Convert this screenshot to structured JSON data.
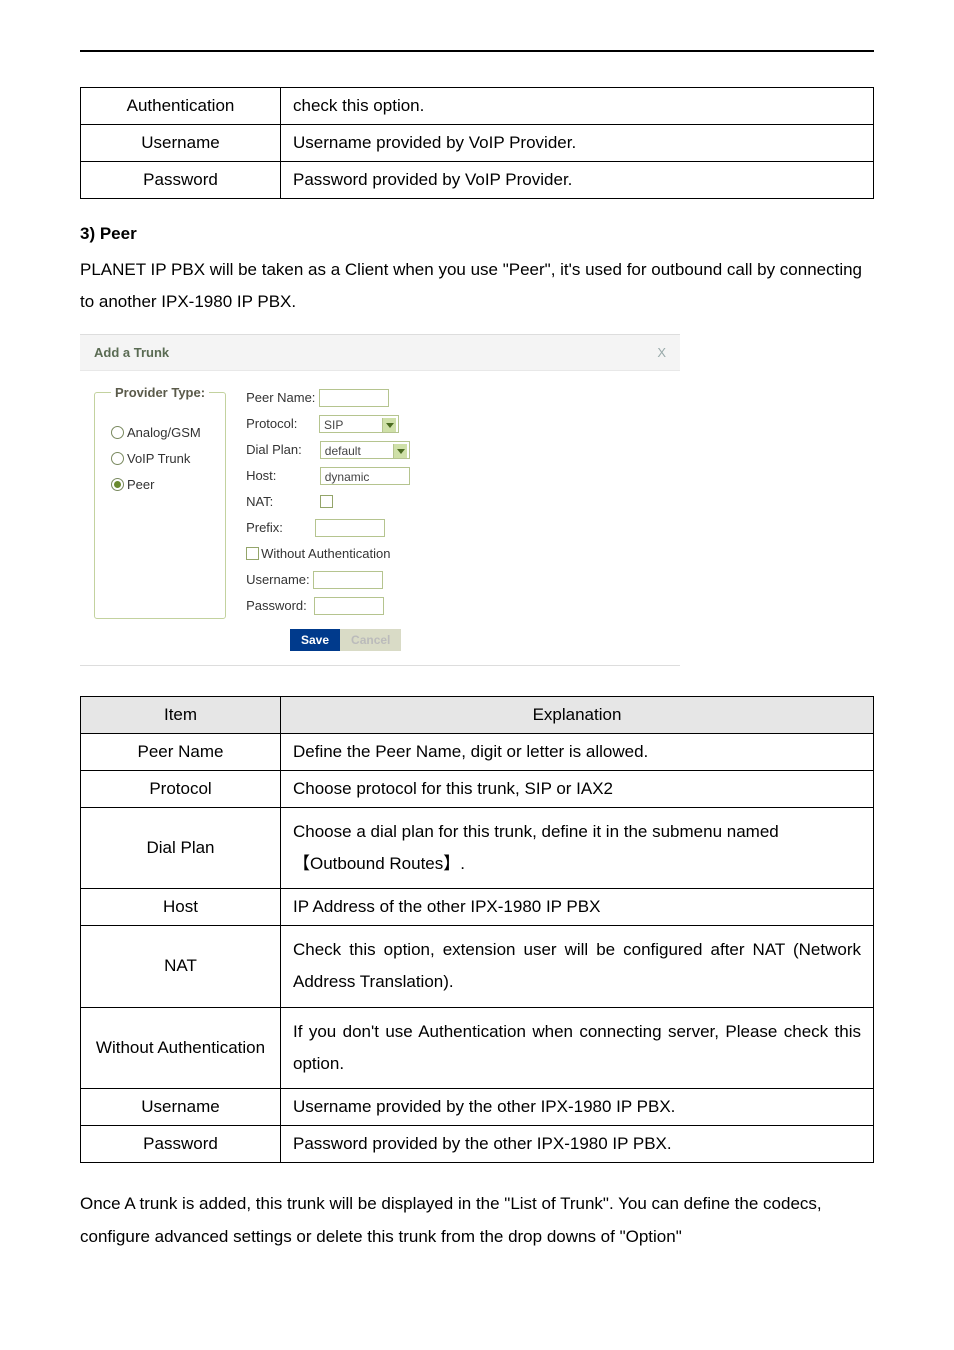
{
  "top_table": {
    "rows": [
      {
        "label": "Authentication",
        "desc": "check this option."
      },
      {
        "label": "Username",
        "desc": "Username provided by VoIP Provider."
      },
      {
        "label": "Password",
        "desc": "Password provided by VoIP Provider."
      }
    ]
  },
  "section": {
    "heading": "3) Peer",
    "para": "PLANET IP PBX will be taken as a Client when you use \"Peer\", it's used for outbound call by connecting to another IPX-1980 IP PBX."
  },
  "dialog": {
    "title": "Add a Trunk",
    "close": "X",
    "legend": "Provider Type:",
    "radios": [
      {
        "label": "Analog/GSM",
        "selected": false
      },
      {
        "label": "VoIP Trunk",
        "selected": false
      },
      {
        "label": "Peer",
        "selected": true
      }
    ],
    "fields": {
      "peer_name_label": "Peer Name:",
      "protocol_label": "Protocol:",
      "protocol_value": "SIP",
      "dial_plan_label": "Dial Plan:",
      "dial_plan_value": "default",
      "host_label": "Host:",
      "host_value": "dynamic",
      "nat_label": "NAT:",
      "prefix_label": "Prefix:",
      "without_auth_label": "Without Authentication",
      "username_label": "Username:",
      "password_label": "Password:"
    },
    "buttons": {
      "save": "Save",
      "cancel": "Cancel"
    }
  },
  "explain_table": {
    "headers": {
      "item": "Item",
      "expl": "Explanation"
    },
    "rows": [
      {
        "label": "Peer Name",
        "desc": "Define the Peer Name, digit or letter is allowed."
      },
      {
        "label": "Protocol",
        "desc": "Choose protocol for this trunk, SIP or IAX2"
      },
      {
        "label": "Dial Plan",
        "desc": "Choose a dial plan for this trunk, define it in the submenu named 【Outbound Routes】."
      },
      {
        "label": "Host",
        "desc": "IP Address of the other IPX-1980 IP PBX"
      },
      {
        "label": "NAT",
        "desc": "Check this option, extension user will be configured after NAT (Network Address Translation)."
      },
      {
        "label": "Without Authentication",
        "desc": "If you don't use Authentication when connecting server, Please check this option."
      },
      {
        "label": "Username",
        "desc": "Username provided by the other IPX-1980 IP PBX."
      },
      {
        "label": "Password",
        "desc": "Password provided by the other IPX-1980 IP PBX."
      }
    ]
  },
  "trailing_para": "Once A trunk is added, this trunk will be displayed in the \"List of Trunk\". You can define the codecs, configure advanced settings or delete this trunk from the drop downs of \"Option\""
}
